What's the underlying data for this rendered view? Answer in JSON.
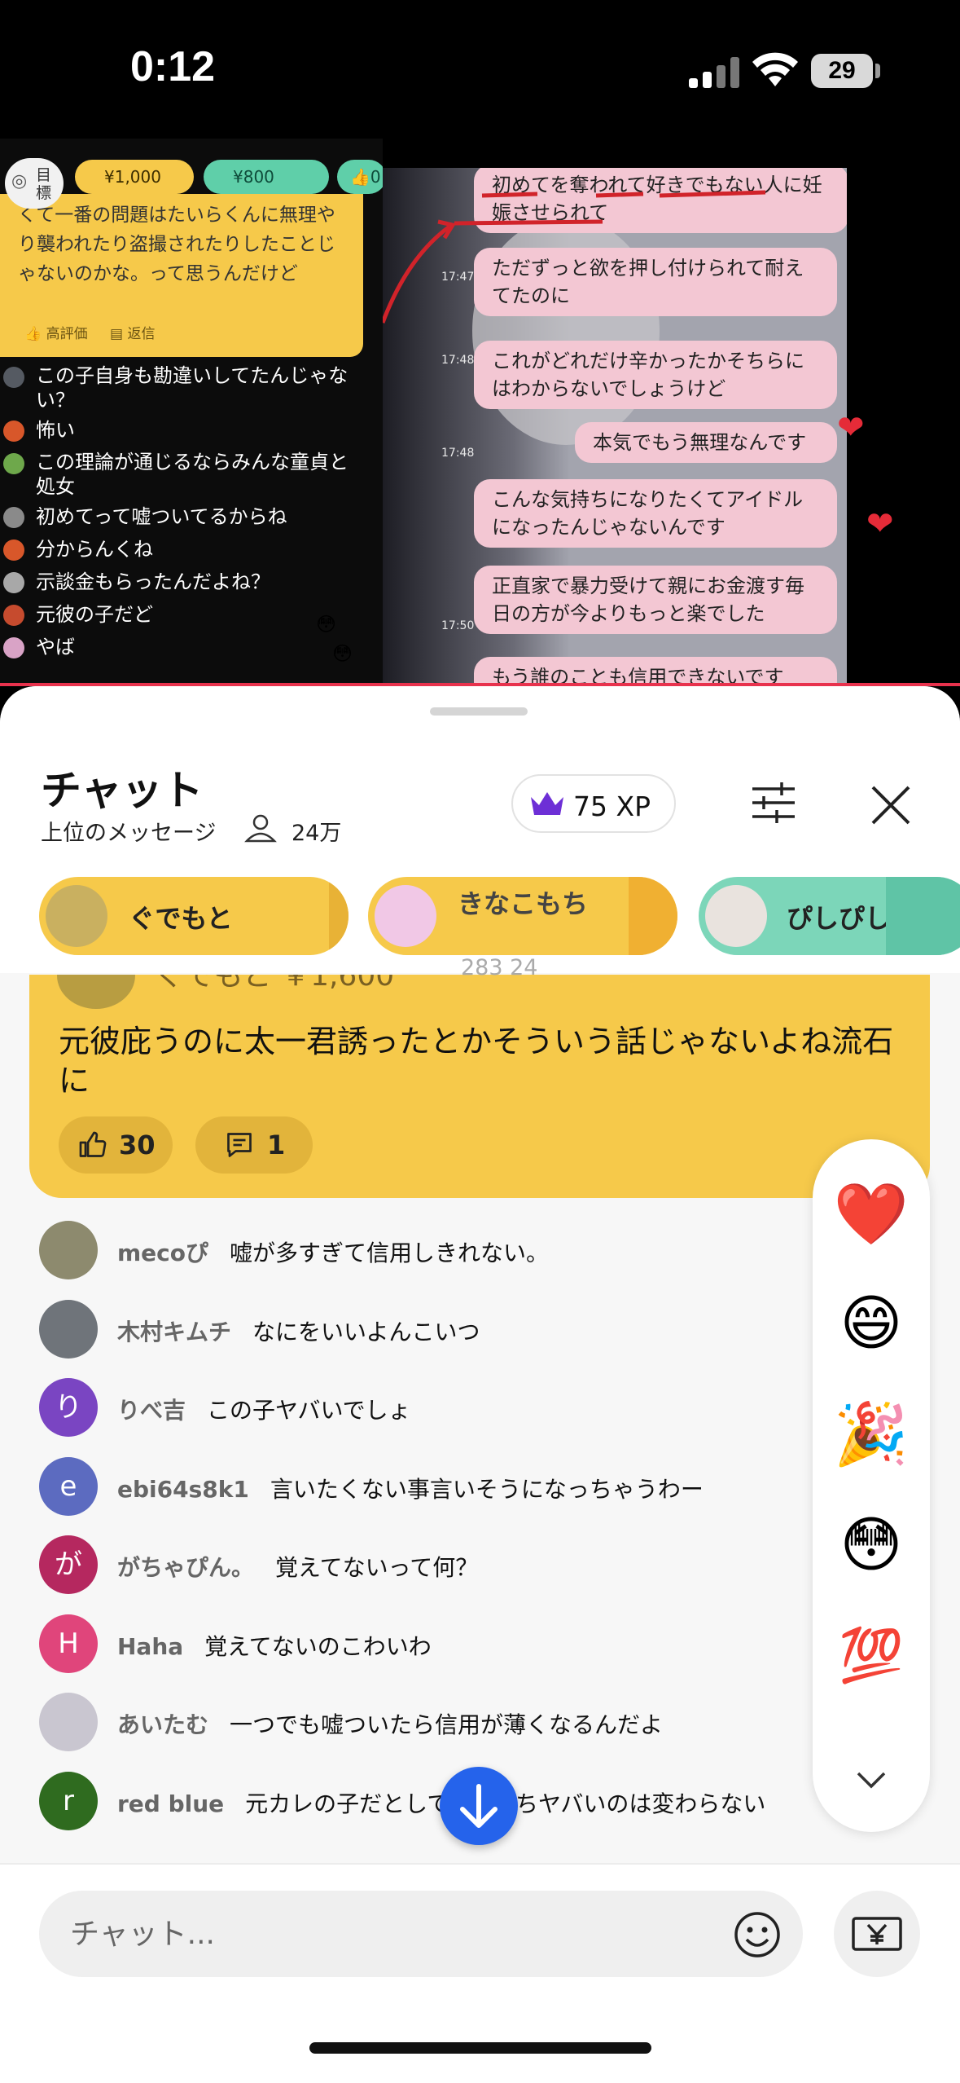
{
  "status": {
    "time": "0:12",
    "battery": "29"
  },
  "video": {
    "goal": "目標",
    "tiers": [
      "¥1,000",
      "¥800",
      "0"
    ],
    "super_chat_text": "くて一番の問題はたいらくんに無理やり襲われたり盗撮されたりしたことじゃないのかな。って思うんだけど",
    "super_chat_like": "高評価",
    "super_chat_reply": "返信",
    "comments": [
      {
        "text": "この子自身も勘違いしてたんじゃない？",
        "color": "#555a62"
      },
      {
        "text": "怖い",
        "color": "#d8572a"
      },
      {
        "text": "この理論が通じるならみんな童貞と処女",
        "color": "#6ea84b"
      },
      {
        "text": "初めてって嘘ついてるからね",
        "color": "#8a8a8a"
      },
      {
        "text": "分からんくね",
        "color": "#d8572a"
      },
      {
        "text": "示談金もらったんだよね？",
        "color": "#a8a8a8"
      },
      {
        "text": "元彼の子だど",
        "color": "#c64b2e"
      },
      {
        "text": "やば",
        "color": "#d9a3c6"
      }
    ],
    "bubbles": [
      "初めてを奪われて好きでもない人に妊娠させられて",
      "ただずっと欲を押し付けられて耐えてたのに",
      "これがどれだけ辛かったかそちらにはわからないでしょうけど",
      "本気でもう無理なんです",
      "こんな気持ちになりたくてアイドルになったんじゃないんです",
      "正直家で暴力受けて親にお金渡す毎日の方が今よりもっと楽でした",
      "もう誰のことも信用できないです"
    ],
    "timestamps": [
      "17:47",
      "17:48",
      "17:48",
      "17:50"
    ]
  },
  "chat": {
    "title": "チャット",
    "filter": "上位のメッセージ",
    "viewers": "24万",
    "xp": "75 XP",
    "pinned": [
      {
        "name": "ぐでもと",
        "color": "#f6c94a"
      },
      {
        "name": "きなこもち",
        "color": "#f6c94a"
      },
      {
        "name": "ぴしぴし",
        "color": "#5fc4a6"
      }
    ],
    "ghost_counts": "283  24",
    "highlight": {
      "head": "ぐでもと ￥1,600",
      "text": "元彼庇うのに太一君誘ったとかそういう話じゃないよね流石に",
      "likes": "30",
      "replies": "1"
    },
    "messages": [
      {
        "author": "mecoぴ",
        "text": "嘘が多すぎて信用しきれない。",
        "avatar": "",
        "bg": "#8d8a6e"
      },
      {
        "author": "木村キムチ",
        "text": "なにをいいよんこいつ",
        "avatar": "",
        "bg": "#6f747a"
      },
      {
        "author": "りべ吉",
        "text": "この子ヤバいでしょ",
        "avatar": "り",
        "bg": "#7a45c2"
      },
      {
        "author": "ebi64s8k1",
        "text": "言いたくない事言いそうになっちゃうわー",
        "avatar": "e",
        "bg": "#5c6bc0"
      },
      {
        "author": "がちゃぴん。",
        "text": "覚えてないって何？",
        "avatar": "が",
        "bg": "#b5285f"
      },
      {
        "author": "Haha",
        "text": "覚えてないのこわいわ",
        "avatar": "H",
        "bg": "#e0457b"
      },
      {
        "author": "あいたむ",
        "text": "一つでも嘘ついたら信用が薄くなるんだよ",
        "avatar": "",
        "bg": "#c9c6d0"
      },
      {
        "author": "red blue",
        "text": "元カレの子だとしてもこっちヤバいのは変わらない",
        "avatar": "r",
        "bg": "#2f6b1f"
      }
    ],
    "reactions": [
      "❤️",
      "😄",
      "🎉",
      "😳",
      "💯"
    ],
    "input_placeholder": "チャット..."
  }
}
